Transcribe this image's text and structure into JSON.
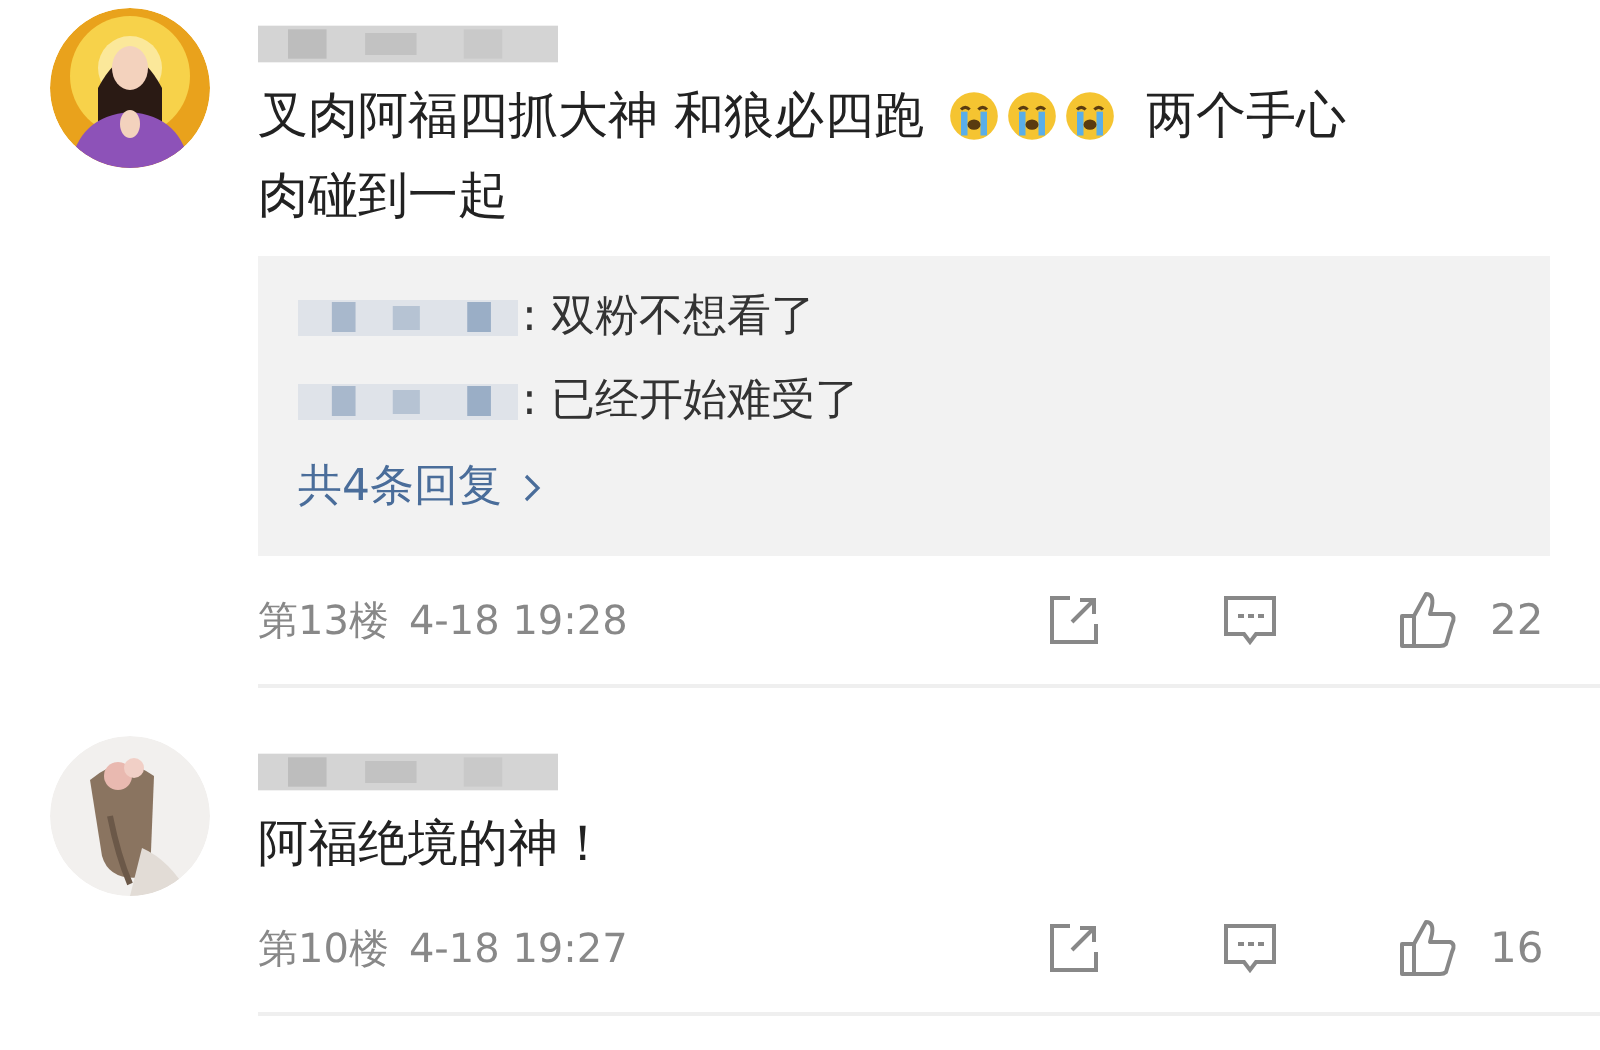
{
  "comments": [
    {
      "avatar": {
        "kind": "picture"
      },
      "content": [
        {
          "kind": "text",
          "text": "叉肉阿福四抓大神 和狼必四跑"
        },
        {
          "kind": "emoji"
        },
        {
          "kind": "emoji"
        },
        {
          "kind": "emoji"
        },
        {
          "kind": "text",
          "text": "两个手心"
        },
        {
          "kind": "text",
          "text": "肉碰到一起"
        }
      ],
      "replies": [
        {
          "text": ": 双粉不想看了"
        },
        {
          "text": ": 已经开始难受了"
        }
      ],
      "more_replies": "共4条回复",
      "floor": "第13楼",
      "time": "4-18 19:28",
      "likes": "22"
    },
    {
      "avatar": {
        "kind": "picture"
      },
      "content": [
        {
          "kind": "text",
          "text": "阿福绝境的神！"
        }
      ],
      "floor": "第10楼",
      "time": "4-18 19:27",
      "likes": "16"
    }
  ]
}
